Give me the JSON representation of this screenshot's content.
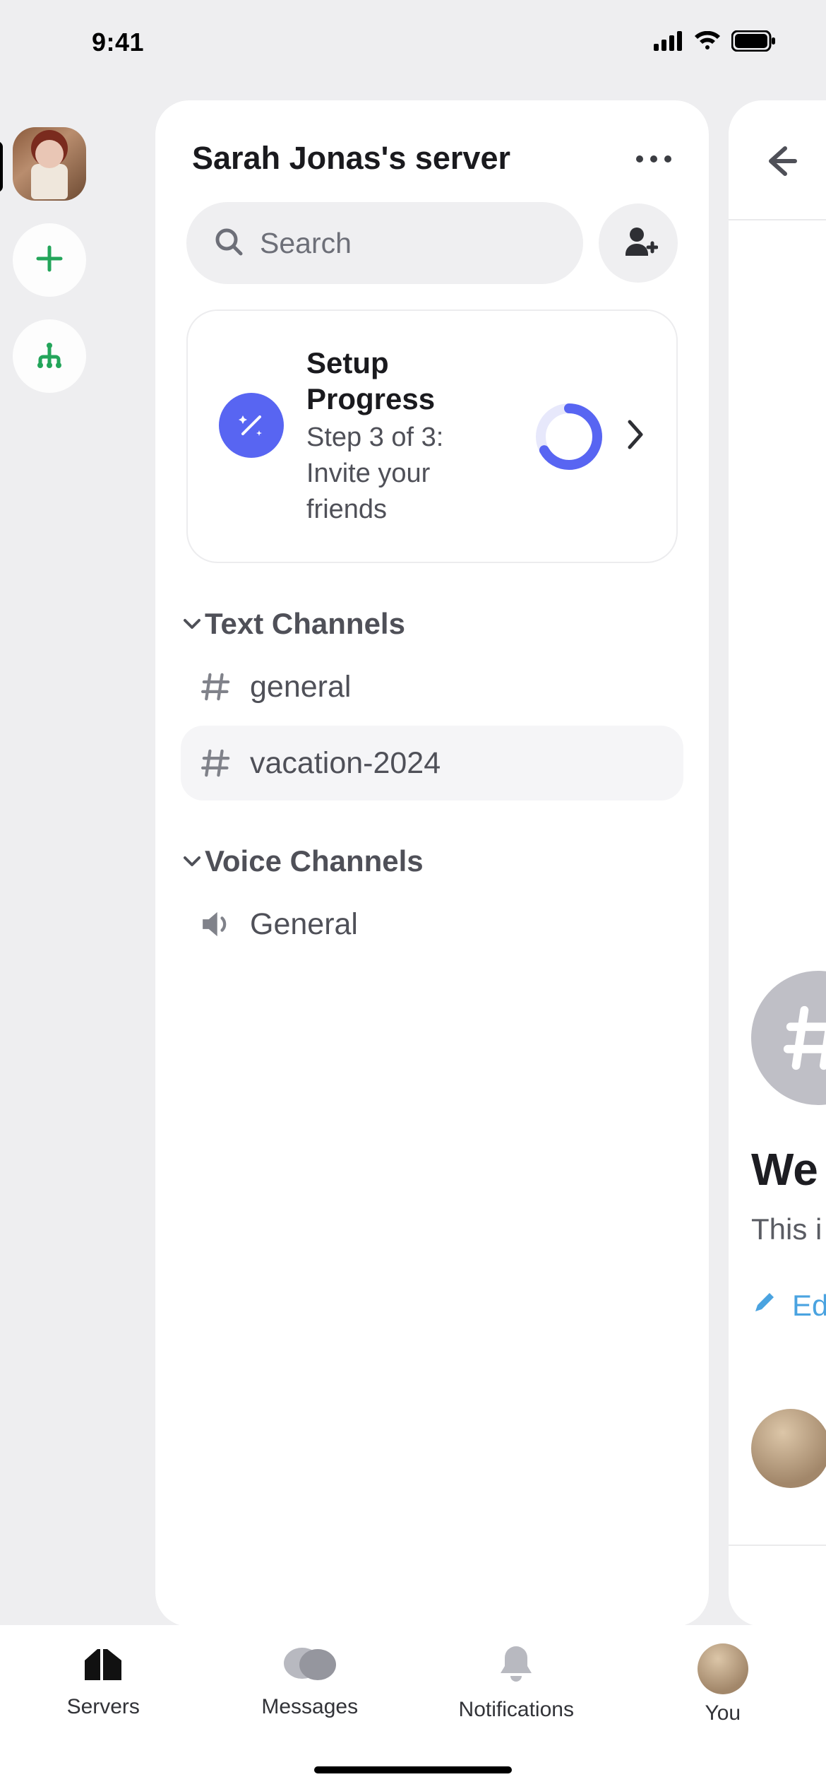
{
  "status": {
    "time": "9:41"
  },
  "server": {
    "title": "Sarah Jonas's server",
    "search_placeholder": "Search"
  },
  "setup": {
    "title": "Setup Progress",
    "subtitle": "Step 3 of 3: Invite your friends",
    "progress_fraction": 0.67
  },
  "sections": {
    "text_label": "Text Channels",
    "voice_label": "Voice Channels"
  },
  "text_channels": [
    {
      "name": "general",
      "active": false
    },
    {
      "name": "vacation-2024",
      "active": true
    }
  ],
  "voice_channels": [
    {
      "name": "General"
    }
  ],
  "peek": {
    "welcome_prefix": "We",
    "sub_prefix": "This i",
    "edit_prefix": "Ed"
  },
  "nav": {
    "servers": "Servers",
    "messages": "Messages",
    "notifications": "Notifications",
    "you": "You"
  },
  "colors": {
    "accent": "#5865f2",
    "rail_green": "#23a55a",
    "link_blue": "#4aa3e0"
  }
}
